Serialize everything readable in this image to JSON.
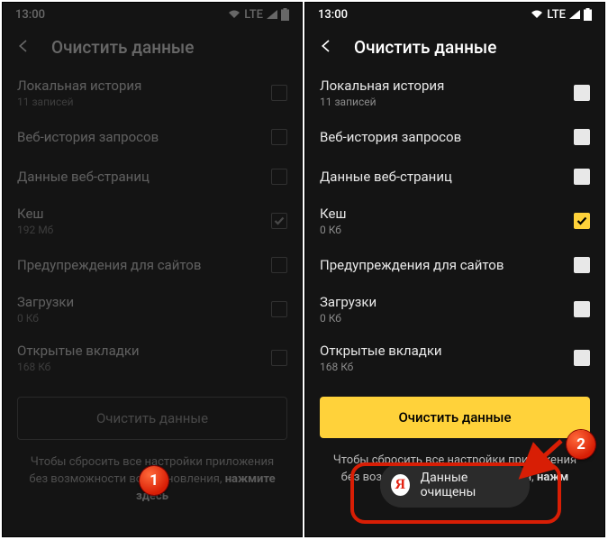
{
  "status": {
    "time": "13:00",
    "net": "LTE"
  },
  "header": {
    "title": "Очистить данные"
  },
  "items_dimmed": [
    {
      "label": "Локальная история",
      "sub": "11 записей",
      "checked": false
    },
    {
      "label": "Веб-история запросов",
      "sub": "",
      "checked": false
    },
    {
      "label": "Данные веб-страниц",
      "sub": "",
      "checked": false
    },
    {
      "label": "Кеш",
      "sub": "192 Мб",
      "checked": true
    },
    {
      "label": "Предупреждения для сайтов",
      "sub": "",
      "checked": false
    },
    {
      "label": "Загрузки",
      "sub": "0 Кб",
      "checked": false
    },
    {
      "label": "Открытые вкладки",
      "sub": "168 Кб",
      "checked": false
    }
  ],
  "items_active": [
    {
      "label": "Локальная история",
      "sub": "11 записей",
      "checked": false
    },
    {
      "label": "Веб-история запросов",
      "sub": "",
      "checked": false
    },
    {
      "label": "Данные веб-страниц",
      "sub": "",
      "checked": false
    },
    {
      "label": "Кеш",
      "sub": "0 Кб",
      "checked": true
    },
    {
      "label": "Предупреждения для сайтов",
      "sub": "",
      "checked": false
    },
    {
      "label": "Загрузки",
      "sub": "0 Кб",
      "checked": false
    },
    {
      "label": "Открытые вкладки",
      "sub": "168 Кб",
      "checked": false
    }
  ],
  "clear_label": "Очистить данные",
  "reset_note_pre": "Чтобы сбросить все настройки приложения без возможности восстановления, ",
  "reset_note_bold": "нажмите здесь",
  "reset_note_pre2": "Чтобы сбросить все настройки приложения без возможности восстановления, ",
  "reset_note_bold2": "нажм",
  "toast": {
    "text": "Данные очищены",
    "y": "Я"
  },
  "steps": {
    "one": "1",
    "two": "2"
  }
}
